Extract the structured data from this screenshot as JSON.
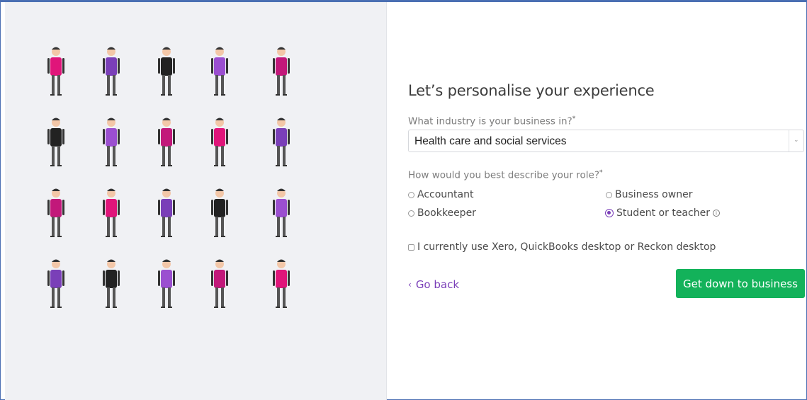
{
  "form": {
    "heading": "Let’s personalise your experience",
    "industry_question": "What industry is your business in?",
    "required_marker": "*",
    "industry_value": "Health care and social services",
    "role_question": "How would you best describe your role?",
    "roles": [
      {
        "label": "Accountant",
        "selected": false
      },
      {
        "label": "Business owner",
        "selected": false
      },
      {
        "label": "Bookkeeper",
        "selected": false
      },
      {
        "label": "Student or teacher",
        "selected": true
      }
    ],
    "desktop_checkbox_label": "I currently use Xero, QuickBooks desktop or Reckon desktop",
    "desktop_checkbox_checked": false,
    "back_label": "Go back",
    "submit_label": "Get down to business"
  },
  "icons": {
    "select_arrow": "chevron-down-icon",
    "info": "info-icon",
    "back": "chevron-left-icon"
  },
  "colors": {
    "accent_purple": "#7a3fb8",
    "magenta": "#e0157a",
    "submit_green": "#13b25a",
    "panel_bg": "#f0f1f4"
  }
}
